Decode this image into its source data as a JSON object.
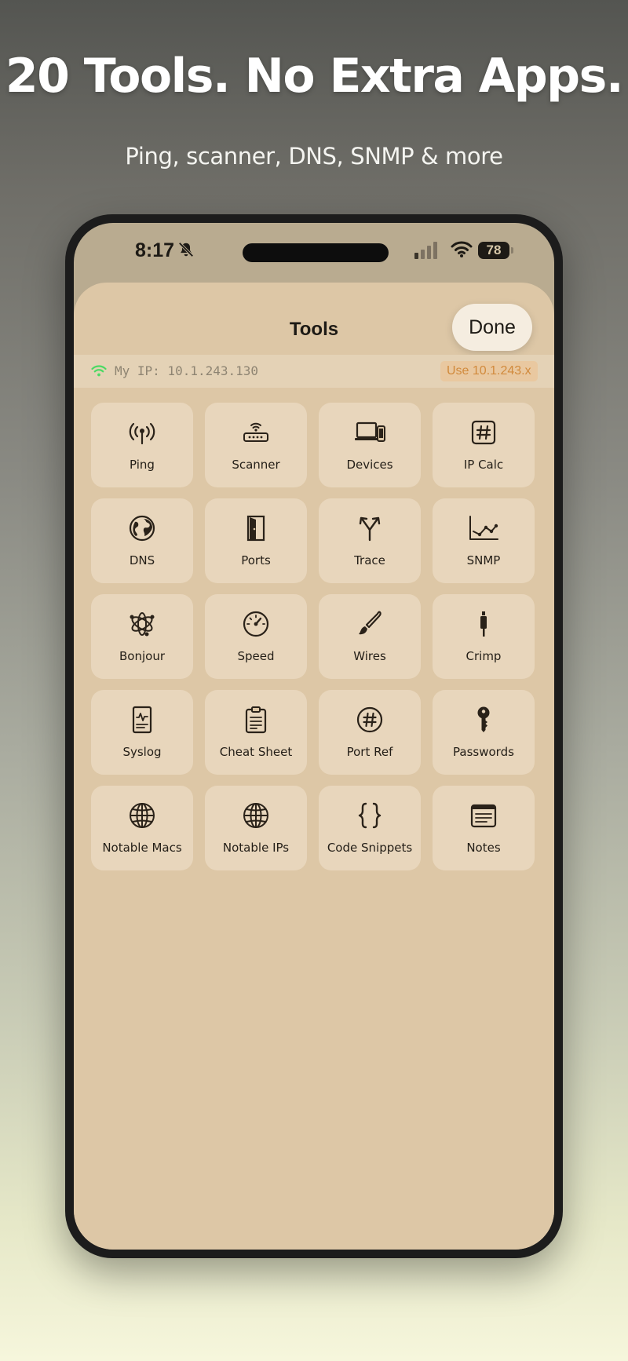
{
  "promo": {
    "headline": "20 Tools. No Extra Apps.",
    "subhead": "Ping, scanner, DNS, SNMP & more"
  },
  "status_bar": {
    "time": "8:17",
    "battery": "78"
  },
  "sheet": {
    "title": "Tools",
    "done_label": "Done"
  },
  "ip_bar": {
    "my_ip": "My IP: 10.1.243.130",
    "use_label": "Use 10.1.243.x"
  },
  "colors": {
    "sheet_background": "#ddc7a6",
    "tile_background": "#e8d6bc",
    "accent_orange": "#d18a3c",
    "wifi_green": "#4cd964"
  },
  "tools": [
    {
      "label": "Ping",
      "icon": "antenna-icon"
    },
    {
      "label": "Scanner",
      "icon": "router-icon"
    },
    {
      "label": "Devices",
      "icon": "devices-icon"
    },
    {
      "label": "IP Calc",
      "icon": "hash-square-icon"
    },
    {
      "label": "DNS",
      "icon": "globe-icon"
    },
    {
      "label": "Ports",
      "icon": "door-icon"
    },
    {
      "label": "Trace",
      "icon": "branch-arrow-icon"
    },
    {
      "label": "SNMP",
      "icon": "line-chart-icon"
    },
    {
      "label": "Bonjour",
      "icon": "bonjour-icon"
    },
    {
      "label": "Speed",
      "icon": "gauge-icon"
    },
    {
      "label": "Wires",
      "icon": "paintbrush-icon"
    },
    {
      "label": "Crimp",
      "icon": "connector-icon"
    },
    {
      "label": "Syslog",
      "icon": "log-document-icon"
    },
    {
      "label": "Cheat Sheet",
      "icon": "clipboard-icon"
    },
    {
      "label": "Port Ref",
      "icon": "hash-circle-icon"
    },
    {
      "label": "Passwords",
      "icon": "key-icon"
    },
    {
      "label": "Notable Macs",
      "icon": "network-globe-icon"
    },
    {
      "label": "Notable IPs",
      "icon": "network-globe-icon"
    },
    {
      "label": "Code Snippets",
      "icon": "curly-braces-icon"
    },
    {
      "label": "Notes",
      "icon": "notes-icon"
    }
  ]
}
